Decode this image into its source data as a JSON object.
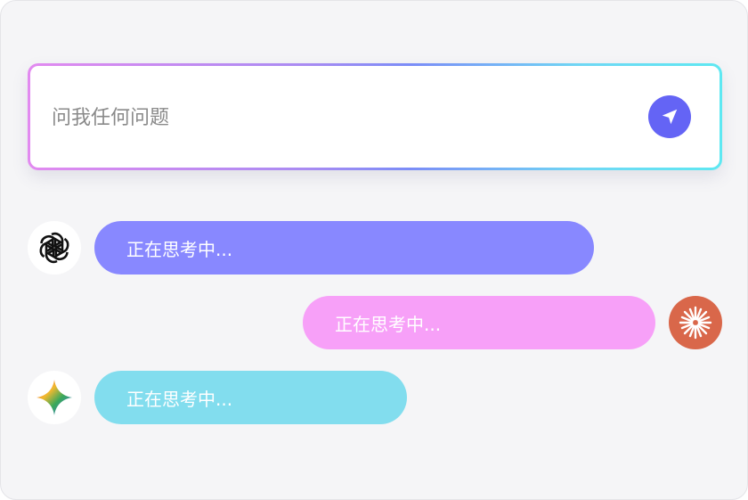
{
  "search": {
    "placeholder": "问我任何问题",
    "send_icon": "send-arrow-icon"
  },
  "messages": [
    {
      "text": "正在思考中...",
      "avatar": "openai-logo",
      "side": "left",
      "color": "#8888ff"
    },
    {
      "text": "正在思考中...",
      "avatar": "claude-logo",
      "side": "right",
      "color": "#f7a0f8"
    },
    {
      "text": "正在思考中...",
      "avatar": "gemini-logo",
      "side": "left",
      "color": "#82ddee"
    }
  ],
  "colors": {
    "background": "#f5f5f7",
    "send_button": "#6464f5",
    "border_gradient": [
      "#e28af0",
      "#7b8cf7",
      "#5ee8f2"
    ]
  }
}
